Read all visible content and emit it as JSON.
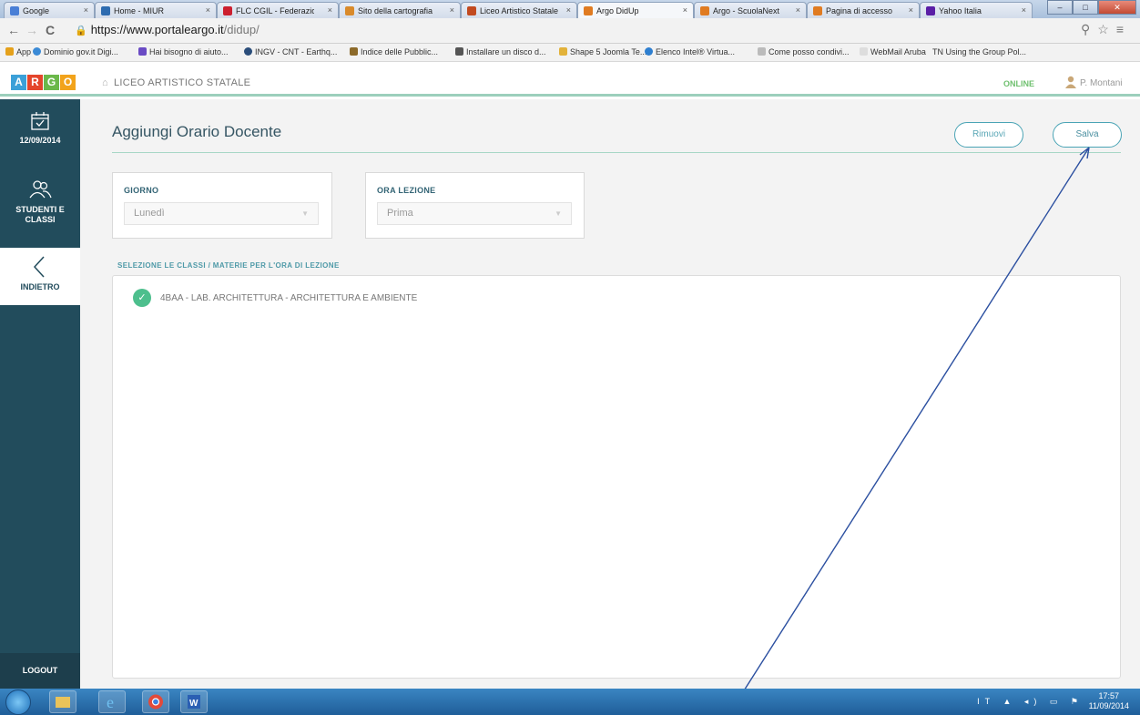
{
  "browser": {
    "tabs": [
      {
        "label": "Google",
        "favicon_color": "#4a7fd6"
      },
      {
        "label": "Home - MIUR",
        "favicon_color": "#2e6cb0"
      },
      {
        "label": "FLC CGIL - Federazio",
        "favicon_color": "#cc1f2f"
      },
      {
        "label": "Sito della cartografia",
        "favicon_color": "#d98a2b"
      },
      {
        "label": "Liceo Artistico Statale",
        "favicon_color": "#c24a1f"
      },
      {
        "label": "Argo DidUp",
        "favicon_color": "#e07b21"
      },
      {
        "label": "Argo - ScuolaNext",
        "favicon_color": "#e07b21"
      },
      {
        "label": "Pagina di accesso",
        "favicon_color": "#e07b21"
      },
      {
        "label": "Yahoo Italia",
        "favicon_color": "#5a1ea6"
      }
    ],
    "tab_close": "×",
    "url_host": "https://www.portaleargo.it",
    "url_path": "/didup/",
    "bookmarks": [
      "App",
      "Dominio gov.it Digi...",
      "Hai bisogno di aiuto...",
      "INGV - CNT - Earthq...",
      "Indice delle Pubblic...",
      "Installare un disco d...",
      "Shape 5 Joomla Te...",
      "Elenco Intel® Virtua...",
      "Come posso condivi...",
      "WebMail Aruba",
      "Using the Group Pol..."
    ]
  },
  "app": {
    "logo_letters": [
      "A",
      "R",
      "G",
      "O"
    ],
    "logo_colors": [
      "#3ba0d8",
      "#e4452b",
      "#6bb84a",
      "#f2a31b"
    ],
    "school": "LICEO ARTISTICO STATALE",
    "status": "ONLINE",
    "user": "P. Montani"
  },
  "sidebar": {
    "date": "12/09/2014",
    "students": "STUDENTI E CLASSI",
    "back": "INDIETRO",
    "logout": "LOGOUT"
  },
  "main": {
    "title": "Aggiungi Orario Docente",
    "remove_label": "Rimuovi",
    "save_label": "Salva",
    "day_label": "GIORNO",
    "day_value": "Lunedì",
    "hour_label": "ORA LEZIONE",
    "hour_value": "Prima",
    "section_label": "SELEZIONE LE CLASSI / MATERIE PER L'ORA DI LEZIONE",
    "items": [
      {
        "text": "4BAA - LAB. ARCHITETTURA - ARCHITETTURA E AMBIENTE",
        "checked": true
      }
    ]
  },
  "taskbar": {
    "tray": "IT",
    "time": "17:57",
    "date": "11/09/2014"
  }
}
